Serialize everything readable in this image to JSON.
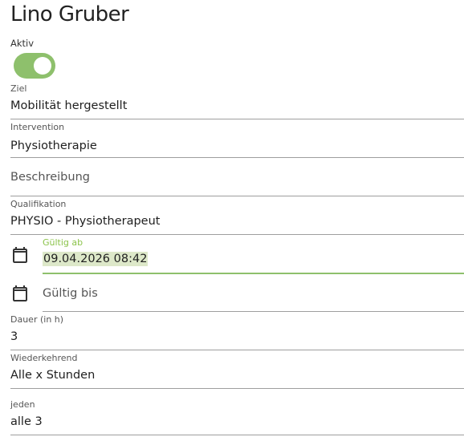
{
  "page": {
    "title": "Lino Gruber"
  },
  "active_toggle": {
    "label": "Aktiv",
    "on": true,
    "color": "#8ec06c"
  },
  "fields": {
    "ziel": {
      "label": "Ziel",
      "value": "Mobilität hergestellt"
    },
    "intervention": {
      "label": "Intervention",
      "value": "Physiotherapie"
    },
    "beschreibung": {
      "placeholder": "Beschreibung",
      "value": ""
    },
    "qualifikation": {
      "label": "Qualifikation",
      "value": "PHYSIO - Physiotherapeut"
    },
    "gueltig_ab": {
      "label": "Gültig ab",
      "value": "09.04.2026 08:42",
      "icon": "calendar-icon"
    },
    "gueltig_bis": {
      "placeholder": "Gültig bis",
      "value": "",
      "icon": "calendar-icon"
    },
    "dauer": {
      "label": "Dauer (in h)",
      "value": "3"
    },
    "wiederkehrend": {
      "label": "Wiederkehrend",
      "value": "Alle x Stunden"
    },
    "jeden": {
      "label": "jeden",
      "value": "alle 3"
    }
  },
  "colors": {
    "accent": "#8bc34a",
    "accent_line": "#8ec06c",
    "selection": "#dde8c9"
  }
}
